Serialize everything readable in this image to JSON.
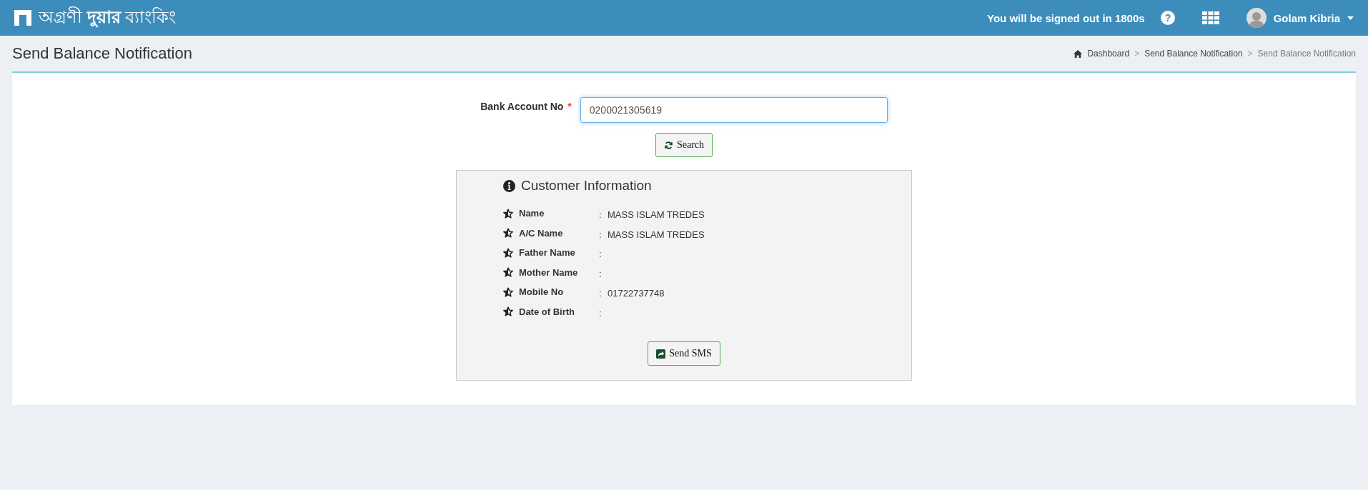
{
  "header": {
    "logo_text": "অগ্রণী **দুয়ার** ব্যাংকিং",
    "session_notice": "You will be signed out in 1800s",
    "help_icon": "?",
    "user_name": "Golam Kibria"
  },
  "page": {
    "title": "Send Balance Notification",
    "breadcrumbs": [
      {
        "label": "Dashboard",
        "current": false
      },
      {
        "separator": ">",
        "label": "Send Balance Notification",
        "current": false
      },
      {
        "separator": ">",
        "label": "Send Balance Notification",
        "current": true
      }
    ]
  },
  "form": {
    "label": "Bank Account No",
    "required_mark": "*",
    "value": "0200021305619",
    "search_button": "Search"
  },
  "customer_info": {
    "title": "Customer Information",
    "fields": [
      {
        "label": "Name",
        "colon": ":",
        "value": "MASS ISLAM TREDES"
      },
      {
        "label": "A/C Name",
        "colon": ":",
        "value": "MASS ISLAM TREDES"
      },
      {
        "label": "Father Name",
        "colon": ":"
      },
      {
        "label": "Mother Name",
        "colon": ":"
      },
      {
        "label": "Mobile No",
        "colon": ":",
        "value": "01722737748"
      },
      {
        "label": "Date of Birth",
        "colon": ":"
      }
    ],
    "send_button": "Send SMS"
  }
}
